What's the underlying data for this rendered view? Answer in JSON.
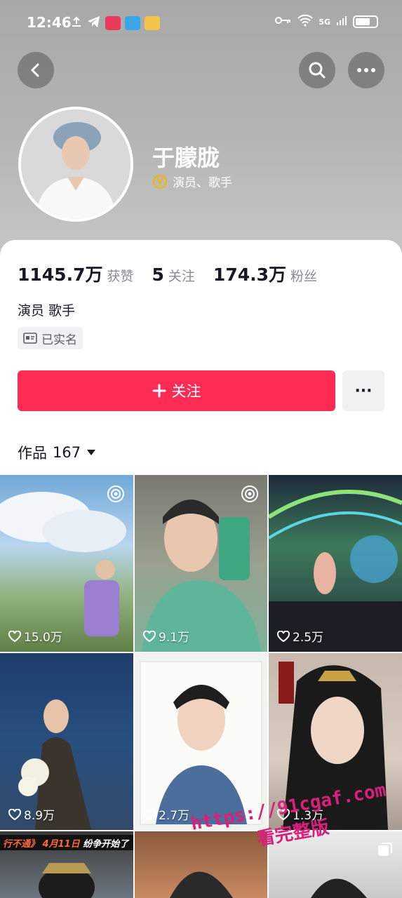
{
  "status_bar": {
    "time": "12:46",
    "network": "5G"
  },
  "profile": {
    "name": "于朦胧",
    "verify_text": "演员、歌手",
    "bio": "演员 歌手",
    "realname_tag": "已实名"
  },
  "stats": {
    "likes_value": "1145.7万",
    "likes_label": "获赞",
    "following_value": "5",
    "following_label": "关注",
    "followers_value": "174.3万",
    "followers_label": "粉丝"
  },
  "actions": {
    "follow_label": "关注",
    "more_label": "···"
  },
  "works": {
    "label": "作品",
    "count": "167"
  },
  "videos": [
    {
      "likes": "15.0万"
    },
    {
      "likes": "9.1万"
    },
    {
      "likes": "2.5万"
    },
    {
      "likes": "8.9万"
    },
    {
      "likes": "2.7万"
    },
    {
      "likes": "1.3万"
    }
  ],
  "banner_text": {
    "title": "行不通》",
    "date": "4月11日",
    "tail": "纷争开始了"
  },
  "watermark": {
    "line1": "https://91cgaf.com",
    "line2": "看完整版"
  },
  "colors": {
    "accent": "#fe2c55",
    "verify": "#f5b400"
  }
}
